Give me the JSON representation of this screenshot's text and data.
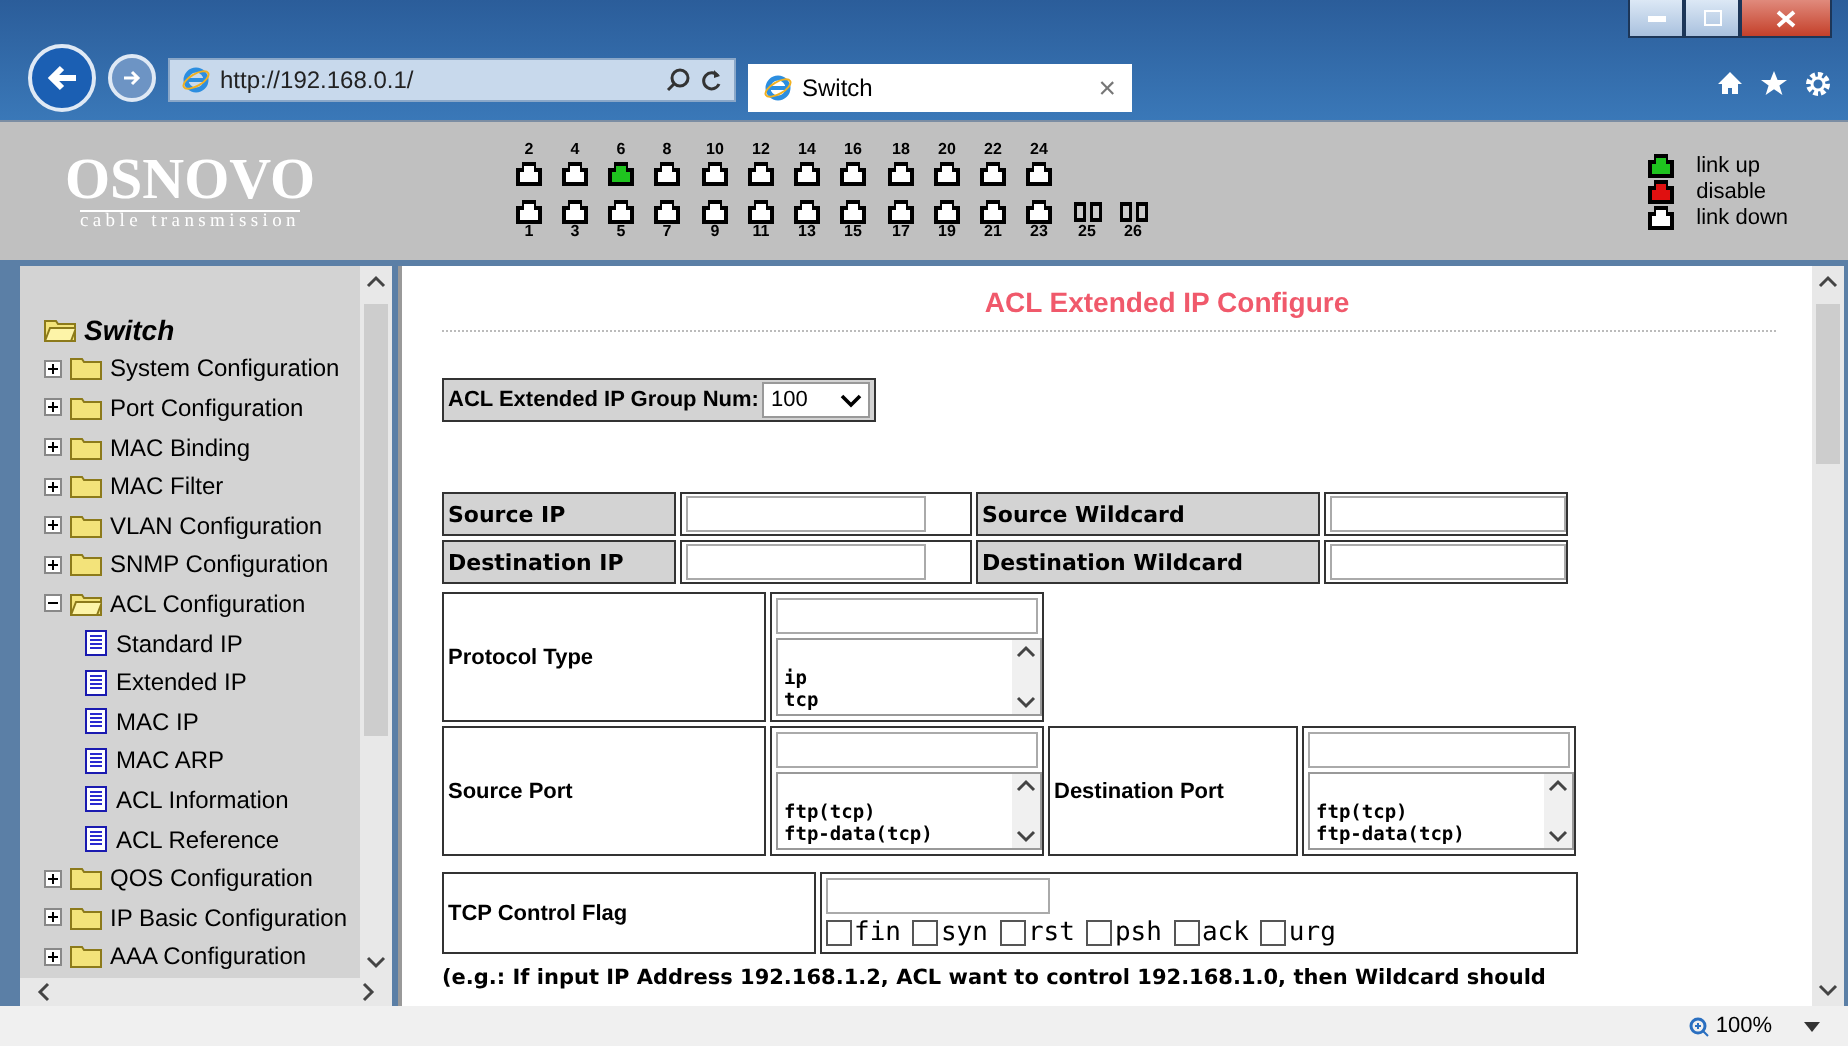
{
  "browser": {
    "url": "http://192.168.0.1/",
    "tab": {
      "title": "Switch",
      "close": "×"
    }
  },
  "header": {
    "logo": "OSNOVO",
    "tagline": "cable transmission",
    "port_groups": [
      [
        {
          "top": {
            "label": "2",
            "color": "#ffffff"
          },
          "bottom": {
            "label": "1",
            "color": "#ffffff"
          }
        },
        {
          "top": {
            "label": "4",
            "color": "#ffffff"
          },
          "bottom": {
            "label": "3",
            "color": "#ffffff"
          }
        },
        {
          "top": {
            "label": "6",
            "color": "#1fc41f"
          },
          "bottom": {
            "label": "5",
            "color": "#ffffff"
          }
        },
        {
          "top": {
            "label": "8",
            "color": "#ffffff"
          },
          "bottom": {
            "label": "7",
            "color": "#ffffff"
          }
        }
      ],
      [
        {
          "top": {
            "label": "10",
            "color": "#ffffff"
          },
          "bottom": {
            "label": "9",
            "color": "#ffffff"
          }
        },
        {
          "top": {
            "label": "12",
            "color": "#ffffff"
          },
          "bottom": {
            "label": "11",
            "color": "#ffffff"
          }
        },
        {
          "top": {
            "label": "14",
            "color": "#ffffff"
          },
          "bottom": {
            "label": "13",
            "color": "#ffffff"
          }
        },
        {
          "top": {
            "label": "16",
            "color": "#ffffff"
          },
          "bottom": {
            "label": "15",
            "color": "#ffffff"
          }
        }
      ],
      [
        {
          "top": {
            "label": "18",
            "color": "#ffffff"
          },
          "bottom": {
            "label": "17",
            "color": "#ffffff"
          }
        },
        {
          "top": {
            "label": "20",
            "color": "#ffffff"
          },
          "bottom": {
            "label": "19",
            "color": "#ffffff"
          }
        },
        {
          "top": {
            "label": "22",
            "color": "#ffffff"
          },
          "bottom": {
            "label": "21",
            "color": "#ffffff"
          }
        },
        {
          "top": {
            "label": "24",
            "color": "#ffffff"
          },
          "bottom": {
            "label": "23",
            "color": "#ffffff"
          }
        }
      ],
      [
        {
          "bottom": {
            "label": "25",
            "kind": "fiber"
          }
        },
        {
          "bottom": {
            "label": "26",
            "kind": "fiber"
          }
        }
      ]
    ],
    "legend": [
      {
        "label": "link up",
        "color": "#1fc41f"
      },
      {
        "label": "disable",
        "color": "#e01010"
      },
      {
        "label": "link down",
        "color": "#ffffff"
      }
    ]
  },
  "sidebar": {
    "root": "Switch",
    "items": [
      {
        "label": "System Configuration",
        "expanded": false
      },
      {
        "label": "Port Configuration",
        "expanded": false
      },
      {
        "label": "MAC Binding",
        "expanded": false
      },
      {
        "label": "MAC Filter",
        "expanded": false
      },
      {
        "label": "VLAN Configuration",
        "expanded": false
      },
      {
        "label": "SNMP Configuration",
        "expanded": false
      },
      {
        "label": "ACL Configuration",
        "expanded": true,
        "children": [
          {
            "label": "Standard IP"
          },
          {
            "label": "Extended IP"
          },
          {
            "label": "MAC IP"
          },
          {
            "label": "MAC ARP"
          },
          {
            "label": "ACL Information"
          },
          {
            "label": "ACL Reference"
          }
        ]
      },
      {
        "label": "QOS Configuration",
        "expanded": false
      },
      {
        "label": "IP Basic Configuration",
        "expanded": false
      },
      {
        "label": "AAA Configuration",
        "expanded": false
      }
    ]
  },
  "content": {
    "title": "ACL Extended IP Configure",
    "group_num": {
      "label": "ACL Extended IP Group Num:",
      "value": "100"
    },
    "address_rows": [
      {
        "label": "Source IP",
        "wildcard_label": "Source Wildcard"
      },
      {
        "label": "Destination IP",
        "wildcard_label": "Destination Wildcard"
      }
    ],
    "protocol": {
      "label": "Protocol Type",
      "options": [
        "ip",
        "tcp"
      ]
    },
    "ports": [
      {
        "label": "Source Port",
        "options": [
          "ftp(tcp)",
          "ftp-data(tcp)"
        ]
      },
      {
        "label": "Destination Port",
        "options": [
          "ftp(tcp)",
          "ftp-data(tcp)"
        ]
      }
    ],
    "tcp_flags": {
      "label": "TCP Control Flag",
      "flags": [
        {
          "label": "fin",
          "checked": false
        },
        {
          "label": "syn",
          "checked": false
        },
        {
          "label": "rst",
          "checked": false
        },
        {
          "label": "psh",
          "checked": false
        },
        {
          "label": "ack",
          "checked": false
        },
        {
          "label": "urg",
          "checked": false
        }
      ]
    },
    "note": "(e.g.: If input IP Address 192.168.1.2, ACL want to control 192.168.1.0, then Wildcard should"
  },
  "status_bar": {
    "zoom": "100%"
  }
}
